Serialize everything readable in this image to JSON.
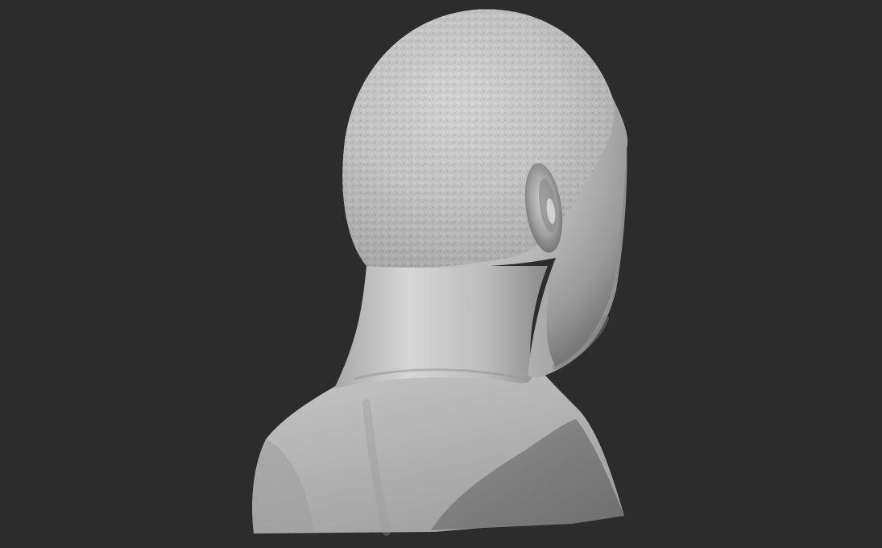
{
  "scene": {
    "subject": "sculpted-bust-rear-three-quarter-view",
    "colors": {
      "background": "#2c2c2c",
      "clay_light": "#dadada",
      "clay_mid": "#b4b4b4",
      "clay_dark": "#7c7c7c",
      "clay_shadow": "#5a5a5a"
    }
  }
}
